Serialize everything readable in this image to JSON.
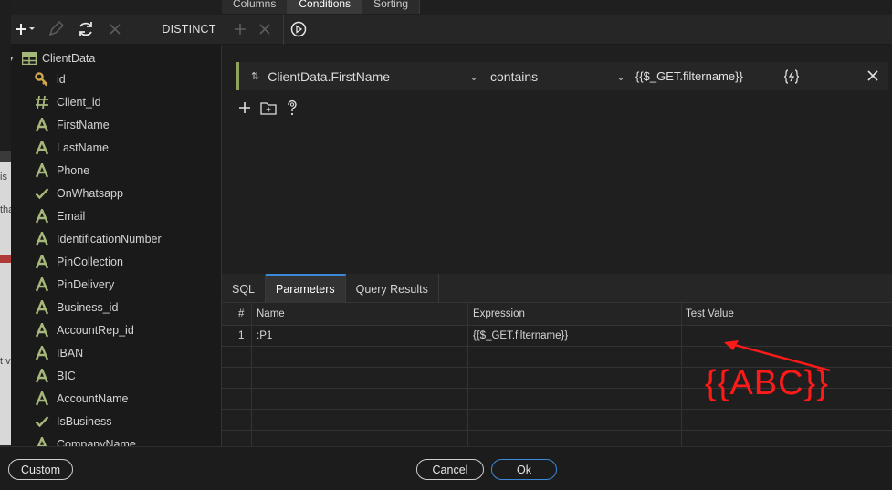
{
  "top_tabs": [
    "Columns",
    "Conditions",
    "Sorting"
  ],
  "toolbar": {
    "distinct_label": "DISTINCT"
  },
  "table": {
    "name": "ClientData",
    "fields": [
      {
        "name": "id",
        "icon": "key-icon"
      },
      {
        "name": "Client_id",
        "icon": "hash-icon"
      },
      {
        "name": "FirstName",
        "icon": "text-field-icon"
      },
      {
        "name": "LastName",
        "icon": "text-field-icon"
      },
      {
        "name": "Phone",
        "icon": "text-field-icon"
      },
      {
        "name": "OnWhatsapp",
        "icon": "check-icon"
      },
      {
        "name": "Email",
        "icon": "text-field-icon"
      },
      {
        "name": "IdentificationNumber",
        "icon": "text-field-icon"
      },
      {
        "name": "PinCollection",
        "icon": "text-field-icon"
      },
      {
        "name": "PinDelivery",
        "icon": "text-field-icon"
      },
      {
        "name": "Business_id",
        "icon": "text-field-icon"
      },
      {
        "name": "AccountRep_id",
        "icon": "text-field-icon"
      },
      {
        "name": "IBAN",
        "icon": "text-field-icon"
      },
      {
        "name": "BIC",
        "icon": "text-field-icon"
      },
      {
        "name": "AccountName",
        "icon": "text-field-icon"
      },
      {
        "name": "IsBusiness",
        "icon": "check-icon"
      },
      {
        "name": "CompanyName",
        "icon": "text-field-icon"
      }
    ]
  },
  "condition": {
    "field": "ClientData.FirstName",
    "operator": "contains",
    "value": "{{$_GET.filtername}}"
  },
  "bottom_tabs": [
    "SQL",
    "Parameters",
    "Query Results"
  ],
  "params": {
    "headers": [
      "#",
      "Name",
      "Expression",
      "Test Value"
    ],
    "rows": [
      {
        "num": "1",
        "name": ":P1",
        "expression": "{{$_GET.filtername}}",
        "test_value": ""
      }
    ]
  },
  "annotation": {
    "text": "{{ABC}}",
    "color": "#ff1a1a"
  },
  "footer": {
    "custom": "Custom",
    "cancel": "Cancel",
    "ok": "Ok"
  },
  "edge_fragments": [
    "is",
    "tha",
    "t v"
  ],
  "colors": {
    "accent": "#3b8ad8",
    "field_icon": "#a6b77a",
    "condition_bar": "#8fa35a"
  }
}
